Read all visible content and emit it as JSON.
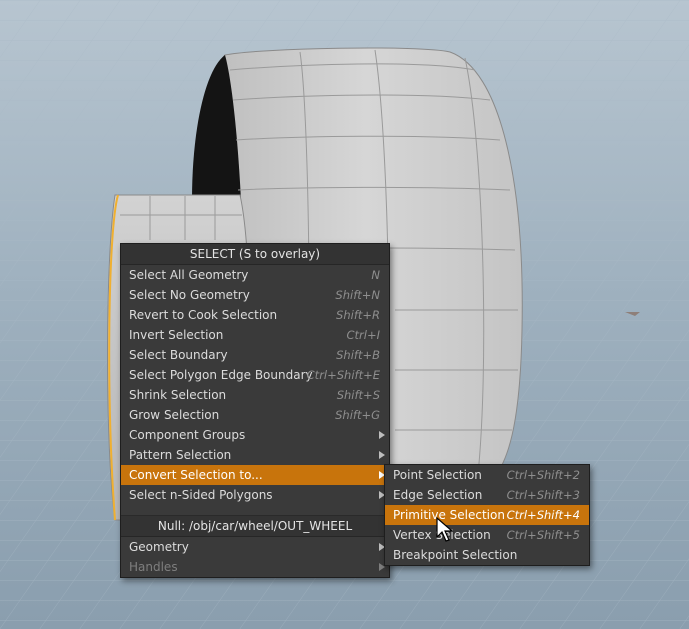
{
  "main_menu": {
    "title": "SELECT (S to overlay)",
    "items": [
      {
        "label": "Select All Geometry",
        "shortcut": "N"
      },
      {
        "label": "Select No Geometry",
        "shortcut": "Shift+N"
      },
      {
        "label": "Revert to Cook Selection",
        "shortcut": "Shift+R"
      },
      {
        "label": "Invert Selection",
        "shortcut": "Ctrl+I"
      },
      {
        "label": "Select Boundary",
        "shortcut": "Shift+B"
      },
      {
        "label": "Select Polygon Edge Boundary",
        "shortcut": "Ctrl+Shift+E"
      },
      {
        "label": "Shrink Selection",
        "shortcut": "Shift+S"
      },
      {
        "label": "Grow Selection",
        "shortcut": "Shift+G"
      },
      {
        "label": "Component Groups"
      },
      {
        "label": "Pattern Selection"
      },
      {
        "label": "Convert Selection to..."
      },
      {
        "label": "Select n-Sided Polygons"
      }
    ],
    "node_title": "Null: /obj/car/wheel/OUT_WHEEL",
    "node_items": [
      {
        "label": "Geometry"
      },
      {
        "label": "Handles"
      }
    ]
  },
  "submenu": {
    "items": [
      {
        "label": "Point Selection",
        "shortcut": "Ctrl+Shift+2"
      },
      {
        "label": "Edge Selection",
        "shortcut": "Ctrl+Shift+3"
      },
      {
        "label": "Primitive Selection",
        "shortcut": "Ctrl+Shift+4"
      },
      {
        "label": "Vertex Selection",
        "shortcut": "Ctrl+Shift+5"
      },
      {
        "label": "Breakpoint Selection"
      }
    ]
  },
  "colors": {
    "menu_bg": "#3a3a3a",
    "highlight": "#c8740c",
    "viewport_bg": "#9fb1bf",
    "selection_outline": "#f0b030"
  }
}
